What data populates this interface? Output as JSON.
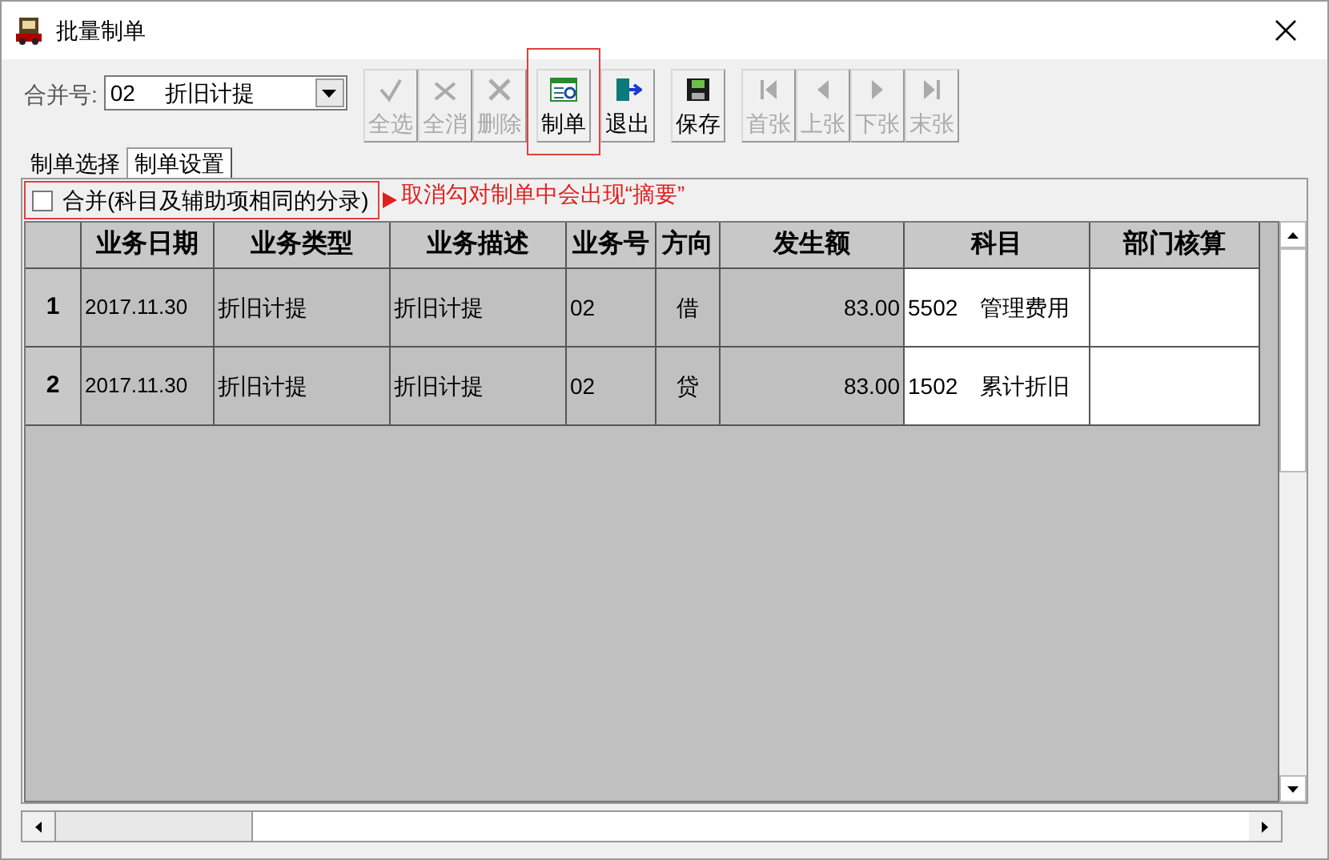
{
  "window": {
    "title": "批量制单"
  },
  "merge_no": {
    "label": "合并号:",
    "value": "02",
    "name": "折旧计提"
  },
  "toolbar": [
    {
      "kind": "checkall",
      "label": "全选",
      "disabled": true,
      "highlighted": false
    },
    {
      "kind": "uncheckall",
      "label": "全消",
      "disabled": true,
      "highlighted": false
    },
    {
      "kind": "delete",
      "label": "删除",
      "disabled": true,
      "highlighted": false
    },
    {
      "kind": "voucher",
      "label": "制单",
      "disabled": false,
      "highlighted": true
    },
    {
      "kind": "exit",
      "label": "退出",
      "disabled": false,
      "highlighted": false
    },
    {
      "kind": "save",
      "label": "保存",
      "disabled": false,
      "highlighted": false
    },
    {
      "kind": "first",
      "label": "首张",
      "disabled": true,
      "highlighted": false
    },
    {
      "kind": "prev",
      "label": "上张",
      "disabled": true,
      "highlighted": false
    },
    {
      "kind": "next",
      "label": "下张",
      "disabled": true,
      "highlighted": false
    },
    {
      "kind": "last",
      "label": "末张",
      "disabled": true,
      "highlighted": false
    }
  ],
  "tabs": [
    {
      "label": "制单选择",
      "selected": false
    },
    {
      "label": "制单设置",
      "selected": true
    }
  ],
  "merge_checkbox": {
    "label": "合并(科目及辅助项相同的分录)",
    "checked": false
  },
  "annotation": "取消勾对制单中会出现“摘要”",
  "table": {
    "columns": [
      "业务日期",
      "业务类型",
      "业务描述",
      "业务号",
      "方向",
      "发生额",
      "科目",
      "部门核算"
    ],
    "rows": [
      {
        "number": "1",
        "cells": [
          "2017.11.30",
          "折旧计提",
          "折旧计提",
          "02",
          "借",
          "83.00",
          "5502　管理费用",
          ""
        ]
      },
      {
        "number": "2",
        "cells": [
          "2017.11.30",
          "折旧计提",
          "折旧计提",
          "02",
          "贷",
          "83.00",
          "1502　累计折旧",
          ""
        ]
      }
    ]
  }
}
